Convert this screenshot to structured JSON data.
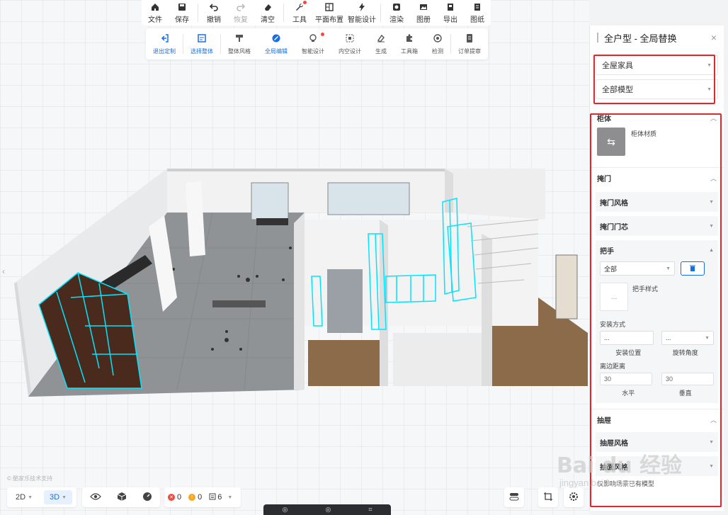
{
  "toolbar_top": {
    "items": [
      {
        "label": "文件",
        "icon": "home-icon"
      },
      {
        "label": "保存",
        "icon": "save-icon"
      },
      {
        "label": "撤销",
        "icon": "undo-icon"
      },
      {
        "label": "恢复",
        "icon": "redo-icon",
        "disabled": true
      },
      {
        "label": "清空",
        "icon": "eraser-icon"
      },
      {
        "label": "工具",
        "icon": "wrench-icon",
        "badge": true
      },
      {
        "label": "平面布置",
        "icon": "layout-icon"
      },
      {
        "label": "智能设计",
        "icon": "lightning-icon"
      },
      {
        "label": "渲染",
        "icon": "camera-icon"
      },
      {
        "label": "图册",
        "icon": "image-icon"
      },
      {
        "label": "导出",
        "icon": "export-icon"
      },
      {
        "label": "图纸",
        "icon": "drawing-icon"
      }
    ]
  },
  "toolbar_sub": {
    "items": [
      {
        "label": "退出定制",
        "icon": "exit-icon",
        "active": true
      },
      {
        "label": "选择整体",
        "icon": "select-all-icon",
        "active": true
      },
      {
        "label": "整体风格",
        "icon": "style-icon"
      },
      {
        "label": "全局编辑",
        "icon": "global-edit-icon",
        "active": true
      },
      {
        "label": "智能设计",
        "icon": "bulb-icon",
        "badge": true
      },
      {
        "label": "内空设计",
        "icon": "inner-space-icon"
      },
      {
        "label": "生成",
        "icon": "generate-icon"
      },
      {
        "label": "工具箱",
        "icon": "puzzle-icon"
      },
      {
        "label": "检测",
        "icon": "detect-icon"
      },
      {
        "label": "订单提审",
        "icon": "order-icon"
      }
    ]
  },
  "bottom_left": {
    "view_2d": "2D",
    "view_3d": "3D",
    "errors": "0",
    "warnings": "0",
    "info": "6"
  },
  "watermark_left": "© 酷家乐技术支持",
  "bottom_dark": [
    "◎",
    "◎",
    "⌗"
  ],
  "panel": {
    "title": "全户型 - 全局替换",
    "dropdown_1": "全屋家具",
    "dropdown_2": "全部模型",
    "section_cabinet": "柜体",
    "cabinet_material": "柜体材质",
    "section_door": "掩门",
    "door_style": "掩门风格",
    "door_core": "掩门门芯",
    "section_handle": "把手",
    "handle_select": "全部",
    "handle_style": "把手样式",
    "handle_style_placeholder": "...",
    "install_method": "安装方式",
    "install_pos_value": "...",
    "install_rot_value": "...",
    "install_position": "安装位置",
    "rotation_angle": "旋转角度",
    "edge_distance": "离边距离",
    "horizontal_value": "30",
    "vertical_value": "30",
    "horizontal": "水平",
    "vertical": "垂直",
    "section_drawer": "抽屉",
    "drawer_style": "抽屉风格",
    "drawer_panel_style": "抽面风格",
    "footer_note": "仅影响场景已有模型"
  },
  "watermark": {
    "brand": "Bai du 经验",
    "url": "jingyan.baidu.com"
  },
  "colors": {
    "accent": "#1a6fe0",
    "highlight": "#e5242b",
    "selection": "#00e5ff",
    "wood": "#4a2a1c"
  }
}
